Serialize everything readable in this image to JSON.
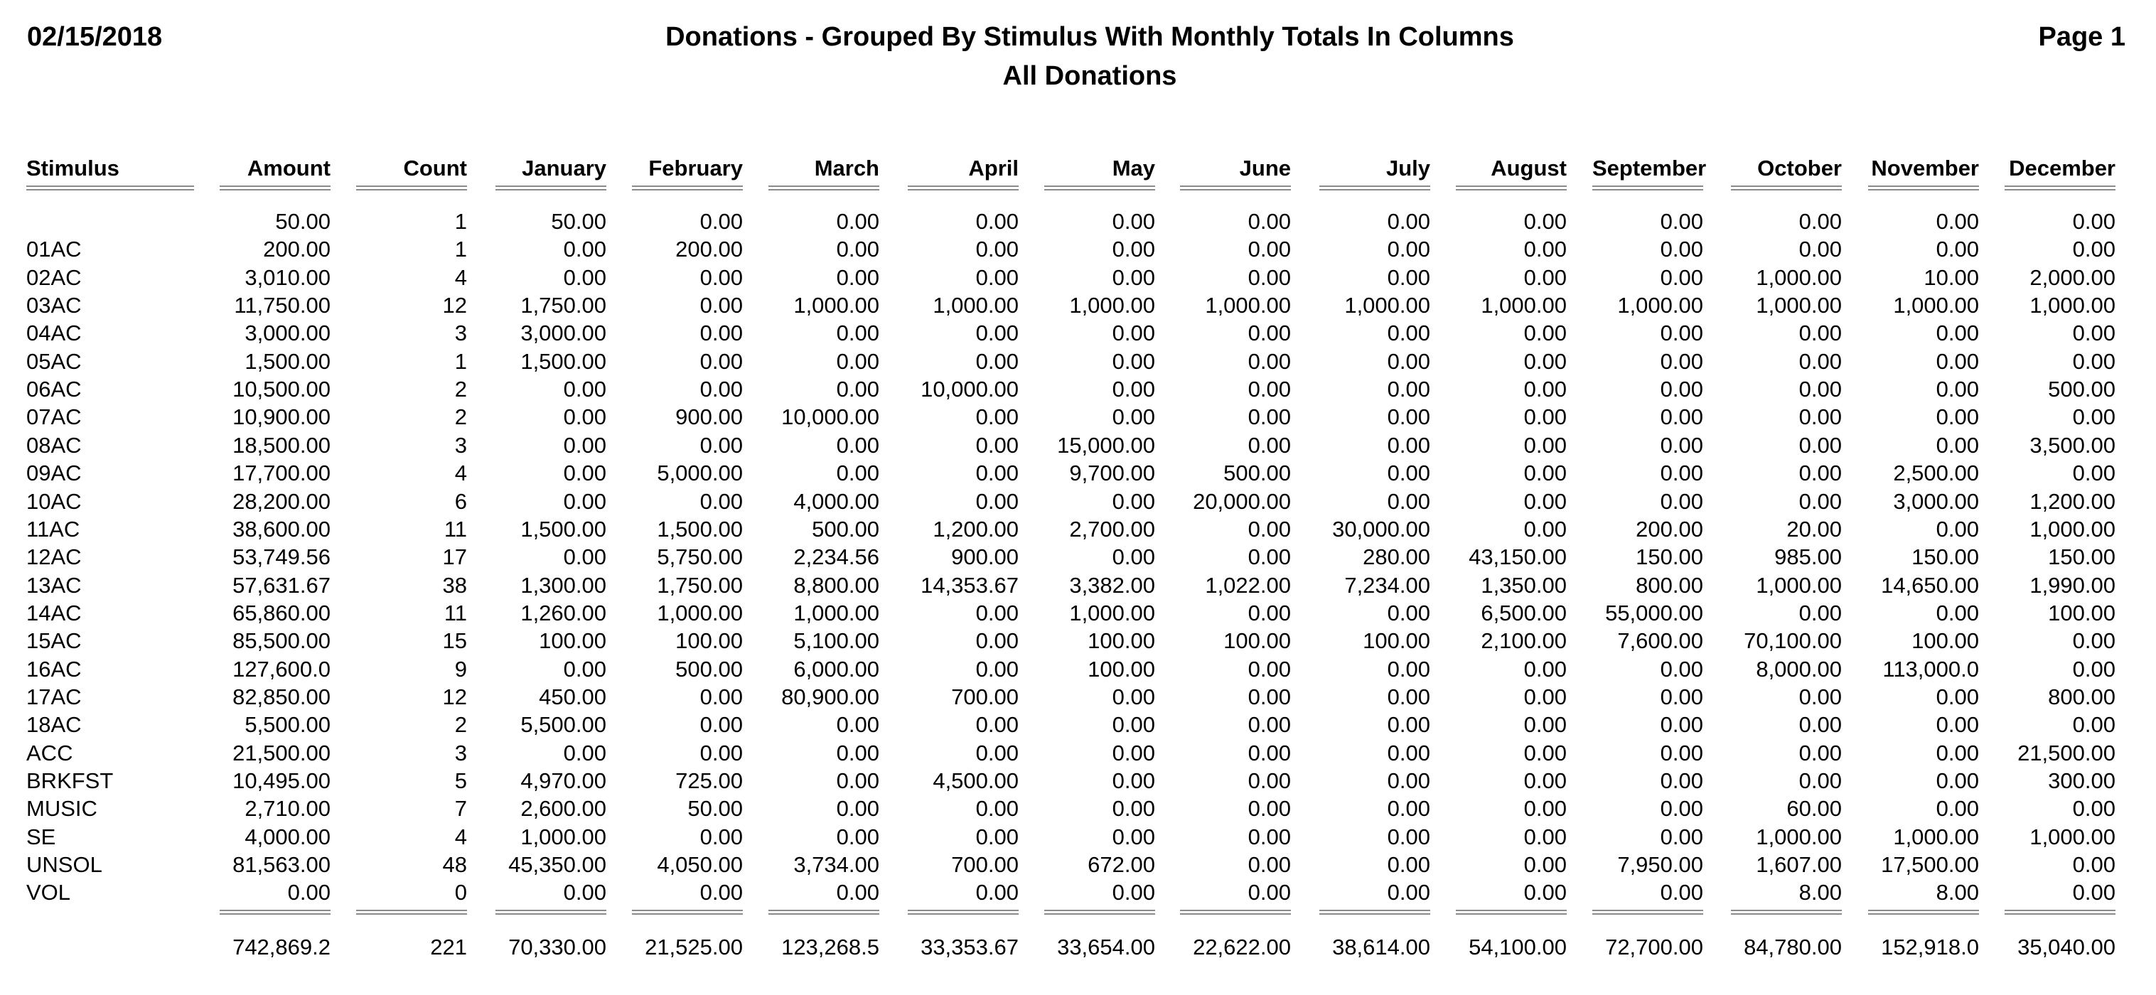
{
  "report": {
    "date": "02/15/2018",
    "title": "Donations - Grouped By Stimulus With Monthly Totals In Columns",
    "subtitle": "All Donations",
    "page": "Page 1"
  },
  "columns": [
    "Stimulus",
    "Amount",
    "Count",
    "January",
    "February",
    "March",
    "April",
    "May",
    "June",
    "July",
    "August",
    "September",
    "October",
    "November",
    "December"
  ],
  "rows": [
    [
      "",
      "50.00",
      "1",
      "50.00",
      "0.00",
      "0.00",
      "0.00",
      "0.00",
      "0.00",
      "0.00",
      "0.00",
      "0.00",
      "0.00",
      "0.00",
      "0.00"
    ],
    [
      "01AC",
      "200.00",
      "1",
      "0.00",
      "200.00",
      "0.00",
      "0.00",
      "0.00",
      "0.00",
      "0.00",
      "0.00",
      "0.00",
      "0.00",
      "0.00",
      "0.00"
    ],
    [
      "02AC",
      "3,010.00",
      "4",
      "0.00",
      "0.00",
      "0.00",
      "0.00",
      "0.00",
      "0.00",
      "0.00",
      "0.00",
      "0.00",
      "1,000.00",
      "10.00",
      "2,000.00"
    ],
    [
      "03AC",
      "11,750.00",
      "12",
      "1,750.00",
      "0.00",
      "1,000.00",
      "1,000.00",
      "1,000.00",
      "1,000.00",
      "1,000.00",
      "1,000.00",
      "1,000.00",
      "1,000.00",
      "1,000.00",
      "1,000.00"
    ],
    [
      "04AC",
      "3,000.00",
      "3",
      "3,000.00",
      "0.00",
      "0.00",
      "0.00",
      "0.00",
      "0.00",
      "0.00",
      "0.00",
      "0.00",
      "0.00",
      "0.00",
      "0.00"
    ],
    [
      "05AC",
      "1,500.00",
      "1",
      "1,500.00",
      "0.00",
      "0.00",
      "0.00",
      "0.00",
      "0.00",
      "0.00",
      "0.00",
      "0.00",
      "0.00",
      "0.00",
      "0.00"
    ],
    [
      "06AC",
      "10,500.00",
      "2",
      "0.00",
      "0.00",
      "0.00",
      "10,000.00",
      "0.00",
      "0.00",
      "0.00",
      "0.00",
      "0.00",
      "0.00",
      "0.00",
      "500.00"
    ],
    [
      "07AC",
      "10,900.00",
      "2",
      "0.00",
      "900.00",
      "10,000.00",
      "0.00",
      "0.00",
      "0.00",
      "0.00",
      "0.00",
      "0.00",
      "0.00",
      "0.00",
      "0.00"
    ],
    [
      "08AC",
      "18,500.00",
      "3",
      "0.00",
      "0.00",
      "0.00",
      "0.00",
      "15,000.00",
      "0.00",
      "0.00",
      "0.00",
      "0.00",
      "0.00",
      "0.00",
      "3,500.00"
    ],
    [
      "09AC",
      "17,700.00",
      "4",
      "0.00",
      "5,000.00",
      "0.00",
      "0.00",
      "9,700.00",
      "500.00",
      "0.00",
      "0.00",
      "0.00",
      "0.00",
      "2,500.00",
      "0.00"
    ],
    [
      "10AC",
      "28,200.00",
      "6",
      "0.00",
      "0.00",
      "4,000.00",
      "0.00",
      "0.00",
      "20,000.00",
      "0.00",
      "0.00",
      "0.00",
      "0.00",
      "3,000.00",
      "1,200.00"
    ],
    [
      "11AC",
      "38,600.00",
      "11",
      "1,500.00",
      "1,500.00",
      "500.00",
      "1,200.00",
      "2,700.00",
      "0.00",
      "30,000.00",
      "0.00",
      "200.00",
      "20.00",
      "0.00",
      "1,000.00"
    ],
    [
      "12AC",
      "53,749.56",
      "17",
      "0.00",
      "5,750.00",
      "2,234.56",
      "900.00",
      "0.00",
      "0.00",
      "280.00",
      "43,150.00",
      "150.00",
      "985.00",
      "150.00",
      "150.00"
    ],
    [
      "13AC",
      "57,631.67",
      "38",
      "1,300.00",
      "1,750.00",
      "8,800.00",
      "14,353.67",
      "3,382.00",
      "1,022.00",
      "7,234.00",
      "1,350.00",
      "800.00",
      "1,000.00",
      "14,650.00",
      "1,990.00"
    ],
    [
      "14AC",
      "65,860.00",
      "11",
      "1,260.00",
      "1,000.00",
      "1,000.00",
      "0.00",
      "1,000.00",
      "0.00",
      "0.00",
      "6,500.00",
      "55,000.00",
      "0.00",
      "0.00",
      "100.00"
    ],
    [
      "15AC",
      "85,500.00",
      "15",
      "100.00",
      "100.00",
      "5,100.00",
      "0.00",
      "100.00",
      "100.00",
      "100.00",
      "2,100.00",
      "7,600.00",
      "70,100.00",
      "100.00",
      "0.00"
    ],
    [
      "16AC",
      "127,600.0",
      "9",
      "0.00",
      "500.00",
      "6,000.00",
      "0.00",
      "100.00",
      "0.00",
      "0.00",
      "0.00",
      "0.00",
      "8,000.00",
      "113,000.0",
      "0.00"
    ],
    [
      "17AC",
      "82,850.00",
      "12",
      "450.00",
      "0.00",
      "80,900.00",
      "700.00",
      "0.00",
      "0.00",
      "0.00",
      "0.00",
      "0.00",
      "0.00",
      "0.00",
      "800.00"
    ],
    [
      "18AC",
      "5,500.00",
      "2",
      "5,500.00",
      "0.00",
      "0.00",
      "0.00",
      "0.00",
      "0.00",
      "0.00",
      "0.00",
      "0.00",
      "0.00",
      "0.00",
      "0.00"
    ],
    [
      "ACC",
      "21,500.00",
      "3",
      "0.00",
      "0.00",
      "0.00",
      "0.00",
      "0.00",
      "0.00",
      "0.00",
      "0.00",
      "0.00",
      "0.00",
      "0.00",
      "21,500.00"
    ],
    [
      "BRKFST",
      "10,495.00",
      "5",
      "4,970.00",
      "725.00",
      "0.00",
      "4,500.00",
      "0.00",
      "0.00",
      "0.00",
      "0.00",
      "0.00",
      "0.00",
      "0.00",
      "300.00"
    ],
    [
      "MUSIC",
      "2,710.00",
      "7",
      "2,600.00",
      "50.00",
      "0.00",
      "0.00",
      "0.00",
      "0.00",
      "0.00",
      "0.00",
      "0.00",
      "60.00",
      "0.00",
      "0.00"
    ],
    [
      "SE",
      "4,000.00",
      "4",
      "1,000.00",
      "0.00",
      "0.00",
      "0.00",
      "0.00",
      "0.00",
      "0.00",
      "0.00",
      "0.00",
      "1,000.00",
      "1,000.00",
      "1,000.00"
    ],
    [
      "UNSOL",
      "81,563.00",
      "48",
      "45,350.00",
      "4,050.00",
      "3,734.00",
      "700.00",
      "672.00",
      "0.00",
      "0.00",
      "0.00",
      "7,950.00",
      "1,607.00",
      "17,500.00",
      "0.00"
    ],
    [
      "VOL",
      "0.00",
      "0",
      "0.00",
      "0.00",
      "0.00",
      "0.00",
      "0.00",
      "0.00",
      "0.00",
      "0.00",
      "0.00",
      "8.00",
      "8.00",
      "0.00"
    ]
  ],
  "totals": [
    "",
    "742,869.2",
    "221",
    "70,330.00",
    "21,525.00",
    "123,268.5",
    "33,353.67",
    "33,654.00",
    "22,622.00",
    "38,614.00",
    "54,100.00",
    "72,700.00",
    "84,780.00",
    "152,918.0",
    "35,040.00"
  ]
}
